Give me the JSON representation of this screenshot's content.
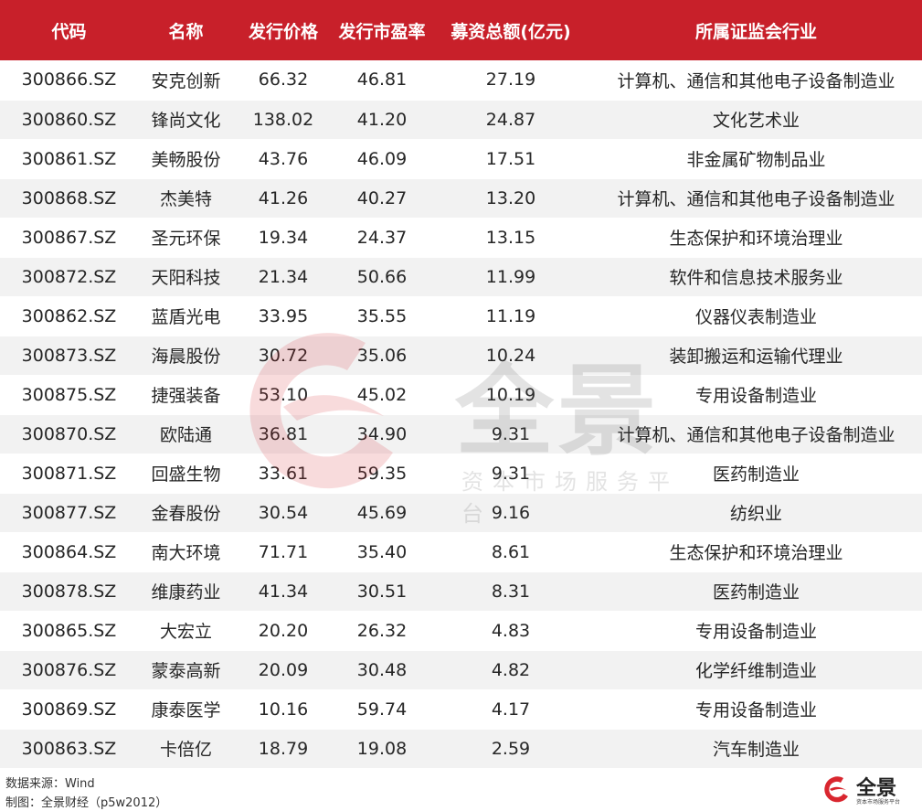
{
  "table": {
    "headers": [
      "代码",
      "名称",
      "发行价格",
      "发行市盈率",
      "募资总额(亿元)",
      "所属证监会行业"
    ],
    "rows": [
      [
        "300866.SZ",
        "安克创新",
        "66.32",
        "46.81",
        "27.19",
        "计算机、通信和其他电子设备制造业"
      ],
      [
        "300860.SZ",
        "锋尚文化",
        "138.02",
        "41.20",
        "24.87",
        "文化艺术业"
      ],
      [
        "300861.SZ",
        "美畅股份",
        "43.76",
        "46.09",
        "17.51",
        "非金属矿物制品业"
      ],
      [
        "300868.SZ",
        "杰美特",
        "41.26",
        "40.27",
        "13.20",
        "计算机、通信和其他电子设备制造业"
      ],
      [
        "300867.SZ",
        "圣元环保",
        "19.34",
        "24.37",
        "13.15",
        "生态保护和环境治理业"
      ],
      [
        "300872.SZ",
        "天阳科技",
        "21.34",
        "50.66",
        "11.99",
        "软件和信息技术服务业"
      ],
      [
        "300862.SZ",
        "蓝盾光电",
        "33.95",
        "35.55",
        "11.19",
        "仪器仪表制造业"
      ],
      [
        "300873.SZ",
        "海晨股份",
        "30.72",
        "35.06",
        "10.24",
        "装卸搬运和运输代理业"
      ],
      [
        "300875.SZ",
        "捷强装备",
        "53.10",
        "45.02",
        "10.19",
        "专用设备制造业"
      ],
      [
        "300870.SZ",
        "欧陆通",
        "36.81",
        "34.90",
        "9.31",
        "计算机、通信和其他电子设备制造业"
      ],
      [
        "300871.SZ",
        "回盛生物",
        "33.61",
        "59.35",
        "9.31",
        "医药制造业"
      ],
      [
        "300877.SZ",
        "金春股份",
        "30.54",
        "45.69",
        "9.16",
        "纺织业"
      ],
      [
        "300864.SZ",
        "南大环境",
        "71.71",
        "35.40",
        "8.61",
        "生态保护和环境治理业"
      ],
      [
        "300878.SZ",
        "维康药业",
        "41.34",
        "30.51",
        "8.31",
        "医药制造业"
      ],
      [
        "300865.SZ",
        "大宏立",
        "20.20",
        "26.32",
        "4.83",
        "专用设备制造业"
      ],
      [
        "300876.SZ",
        "蒙泰高新",
        "20.09",
        "30.48",
        "4.82",
        "化学纤维制造业"
      ],
      [
        "300869.SZ",
        "康泰医学",
        "10.16",
        "59.74",
        "4.17",
        "专用设备制造业"
      ],
      [
        "300863.SZ",
        "卡倍亿",
        "18.79",
        "19.08",
        "2.59",
        "汽车制造业"
      ]
    ]
  },
  "footer": {
    "source": "数据来源：Wind",
    "credit": "制图：全景财经（p5w2012）"
  },
  "watermark": {
    "brand": "全景",
    "tagline": "资本市场服务平台"
  },
  "logo": {
    "brand": "全景",
    "tagline": "资本市场服务平台"
  },
  "colors": {
    "header_bg": "#c8202a",
    "stripe": "#f2f2f2",
    "brand_red": "#d9262f"
  }
}
